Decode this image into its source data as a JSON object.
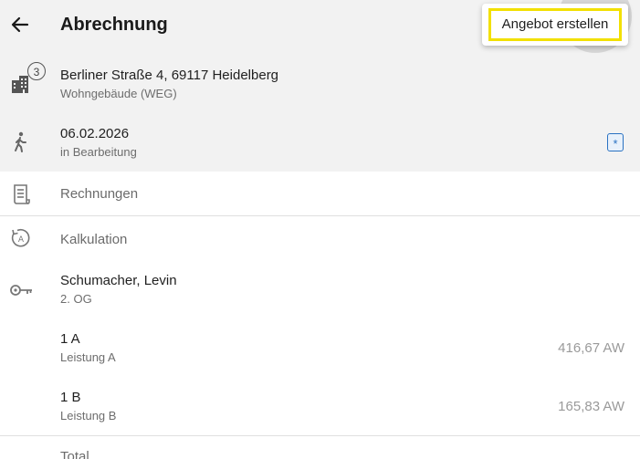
{
  "header": {
    "title": "Abrechnung"
  },
  "popup_menu": {
    "item_label": "Angebot erstellen",
    "highlight_color": "#f2e000"
  },
  "property": {
    "address": "Berliner Straße 4, 69117 Heidelberg",
    "type": "Wohngebäude (WEG)",
    "unit_count": "3",
    "icon": "building-icon"
  },
  "status": {
    "date": "06.02.2026",
    "state": "in Bearbeitung",
    "icon": "walking-person-icon",
    "badge": "*"
  },
  "sections": {
    "rechnungen": "Rechnungen",
    "kalkulation": "Kalkulation"
  },
  "tenant": {
    "name": "Schumacher, Levin",
    "floor": "2. OG",
    "icon": "key-icon"
  },
  "line_items": [
    {
      "code": "1 A",
      "description": "Leistung A",
      "amount": "416,67 AW"
    },
    {
      "code": "1 B",
      "description": "Leistung B",
      "amount": "165,83 AW"
    }
  ],
  "footer": {
    "total_label": "Total"
  },
  "colors": {
    "header_bg": "#f2f2f2",
    "accent_blue": "#2a72c2"
  }
}
